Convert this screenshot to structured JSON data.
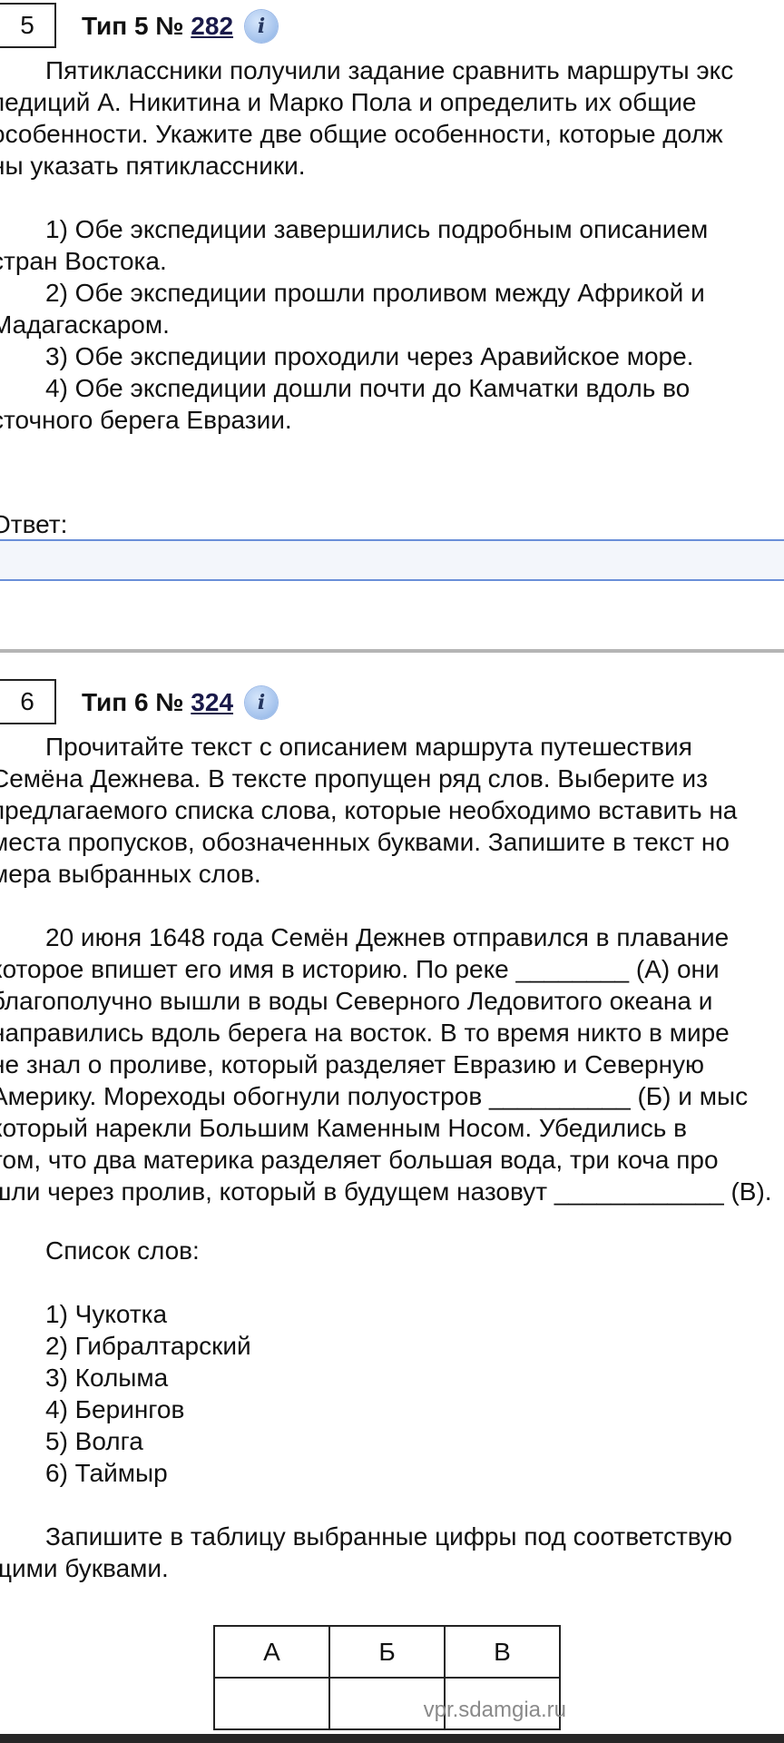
{
  "q5": {
    "number": "5",
    "type_label": "Тип 5 № ",
    "task_id": "282",
    "info_icon": "i",
    "paragraph": [
      "Пятиклассники получили задание сравнить маршруты экс",
      "педиций А. Никитина и Марко Пола и определить их общие",
      "особенности. Укажите две общие особенности, которые долж",
      "ны указать пятиклассники."
    ],
    "options": [
      "1) Обе экспедиции завершились подробным описанием",
      "стран Востока.",
      "2) Обе экспедиции прошли проливом между Африкой и",
      "Мадагаскаром.",
      "3) Обе экспедиции проходили через Аравийское море.",
      "4) Обе экспедиции дошли почти до Камчатки вдоль во",
      "сточного берега Евразии."
    ],
    "answer_label": "Ответ:",
    "answer_value": ""
  },
  "q6": {
    "number": "6",
    "type_label": "Тип 6 № ",
    "task_id": "324",
    "info_icon": "i",
    "intro": [
      "Прочитайте текст с описанием маршрута путешествия",
      "Семёна Дежнева. В тексте пропущен ряд слов. Выберите из",
      "предлагаемого списка слова, которые необходимо вставить на",
      "места пропусков, обозначенных буквами. Запишите в текст но",
      "мера выбранных слов."
    ],
    "story": [
      "20 июня 1648 года Семён Дежнев отправился в плавание",
      "которое впишет его имя в историю. По реке ________ (А) они",
      "благополучно вышли в воды Северного Ледовитого океана и",
      "направились вдоль берега на восток. В то время никто в мире",
      "не знал о проливе, который разделяет Евразию и Северную",
      "Америку. Мореходы обогнули полуостров __________ (Б) и мыс",
      "который нарекли Большим Каменным Носом. Убедились в",
      "том, что два материка разделяет большая вода, три коча про",
      "шли через пролив, который в будущем назовут ____________ (В)."
    ],
    "list_title": "Список слов:",
    "words": [
      "1)  Чукотка",
      "2)  Гибралтарский",
      "3)  Колыма",
      "4)  Берингов",
      "5)  Волга",
      "6)  Таймыр"
    ],
    "instruction": [
      "Запишите в таблицу выбранные цифры под соответствую",
      "щими буквами."
    ],
    "table_headers": [
      "А",
      "Б",
      "В"
    ],
    "table_values": [
      "",
      "",
      ""
    ]
  },
  "watermark": "vpr.sdamgia.ru"
}
